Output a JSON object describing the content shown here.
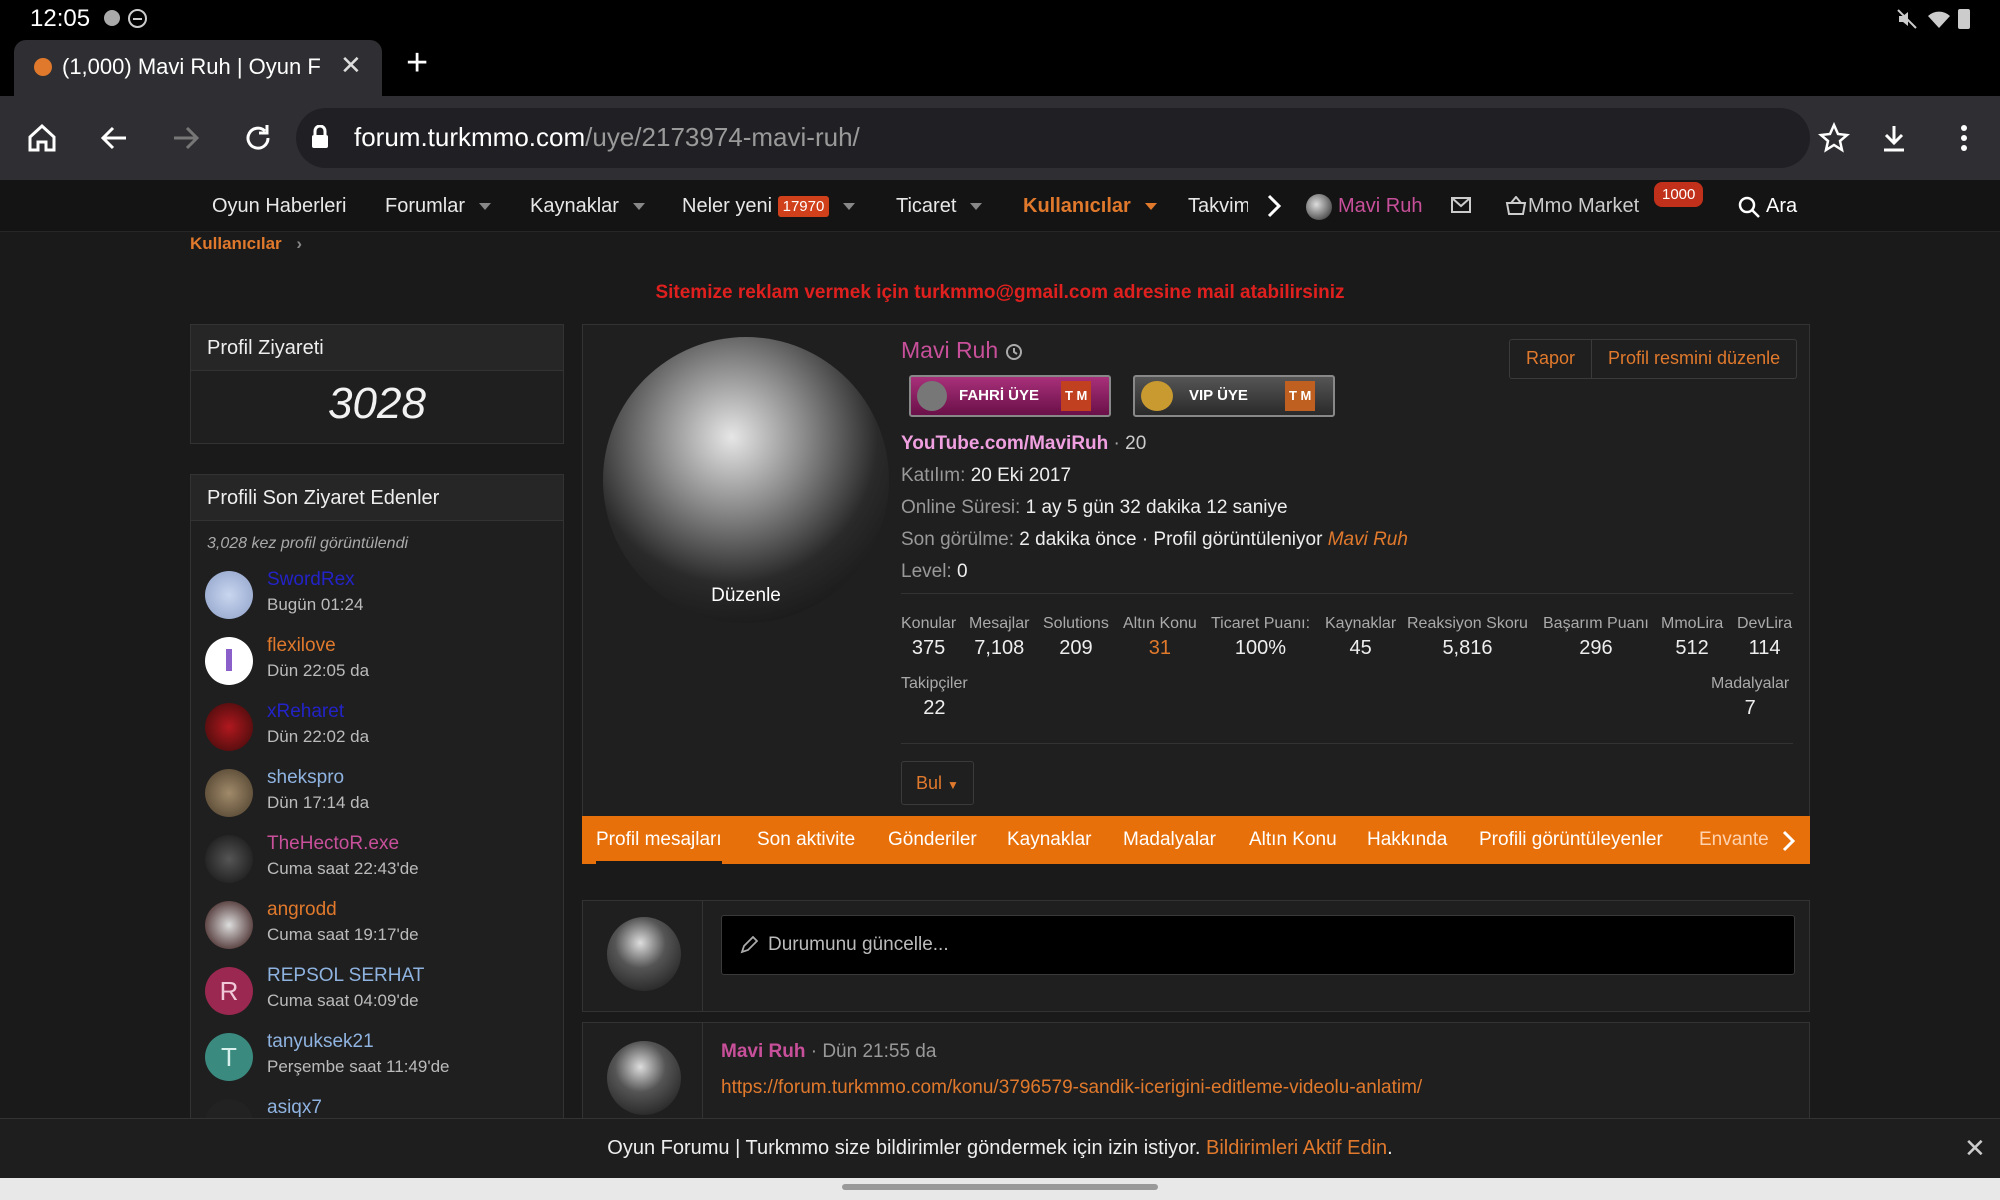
{
  "status_bar": {
    "time": "12:05"
  },
  "browser": {
    "tab_title": "(1,000) Mavi Ruh | Oyun F",
    "url_domain": "forum.turkmmo.com",
    "url_path": "/uye/2173974-mavi-ruh/"
  },
  "forum_nav": {
    "items": [
      "Oyun Haberleri",
      "Forumlar",
      "Kaynaklar",
      "Neler yeni",
      "Ticaret",
      "Kullanıcılar",
      "Takvim"
    ],
    "new_badge": "17970",
    "user_name": "Mavi Ruh",
    "market_label": "Mmo Market",
    "market_badge": "1000",
    "search_label": "Ara"
  },
  "breadcrumb": {
    "label": "Kullanıcılar"
  },
  "ad_banner": "Sitemize reklam vermek için turkmmo@gmail.com adresine mail atabilirsiniz",
  "sidebar": {
    "visits_title": "Profil Ziyareti",
    "visits_count": "3028",
    "recent_title": "Profili Son Ziyaret Edenler",
    "recent_summary": "3,028 kez profil görüntülendi",
    "visitors": [
      {
        "name": "SwordRex",
        "time": "Bugün 01:24",
        "color": "#2323c8"
      },
      {
        "name": "flexilove",
        "time": "Dün 22:05 da",
        "color": "#e0792c"
      },
      {
        "name": "xReharet",
        "time": "Dün 22:02 da",
        "color": "#2323c8"
      },
      {
        "name": "shekspro",
        "time": "Dün 17:14 da",
        "color": "#8fb3e0"
      },
      {
        "name": "TheHectoR.exe",
        "time": "Cuma saat 22:43'de",
        "color": "#c8509a"
      },
      {
        "name": "angrodd",
        "time": "Cuma saat 19:17'de",
        "color": "#e0792c"
      },
      {
        "name": "REPSOL SERHAT",
        "time": "Cuma saat 04:09'de",
        "color": "#8fb3e0"
      },
      {
        "name": "tanyuksek21",
        "time": "Perşembe saat 11:49'de",
        "color": "#8fb3e0"
      },
      {
        "name": "asiqx7",
        "time": "",
        "color": "#8fb3e0"
      }
    ],
    "avatar_letters": {
      "repsol": "R",
      "tanyuksek": "T"
    }
  },
  "profile": {
    "name": "Mavi Ruh",
    "edit_avatar": "Düzenle",
    "badge1": "FAHRİ ÜYE",
    "badge2": "VIP ÜYE",
    "badge_tm": "T M",
    "custom_title": "YouTube.com/MaviRuh",
    "age": "20",
    "joined_label": "Katılım:",
    "joined_value": "20 Eki 2017",
    "online_label": "Online Süresi:",
    "online_value": "1 ay 5 gün 32 dakika 12 saniye",
    "lastseen_label": "Son görülme:",
    "lastseen_value": "2 dakika önce · Profil görüntüleniyor",
    "lastseen_user": "Mavi Ruh",
    "level_label": "Level:",
    "level_value": "0",
    "report_button": "Rapor",
    "edit_button": "Profil resmini düzenle",
    "find_button": "Bul",
    "stats": [
      {
        "label": "Konular",
        "value": "375"
      },
      {
        "label": "Mesajlar",
        "value": "7,108"
      },
      {
        "label": "Solutions",
        "value": "209"
      },
      {
        "label": "Altın Konu",
        "value": "31"
      },
      {
        "label": "Ticaret Puanı:",
        "value": "100%"
      },
      {
        "label": "Kaynaklar",
        "value": "45"
      },
      {
        "label": "Reaksiyon Skoru",
        "value": "5,816"
      },
      {
        "label": "Başarım Puanı",
        "value": "296"
      },
      {
        "label": "MmoLira",
        "value": "512"
      },
      {
        "label": "DevLira",
        "value": "114"
      }
    ],
    "followers_label": "Takipçiler",
    "followers_value": "22",
    "medals_label": "Madalyalar",
    "medals_value": "7"
  },
  "profile_tabs": [
    "Profil mesajları",
    "Son aktivite",
    "Gönderiler",
    "Kaynaklar",
    "Madalyalar",
    "Altın Konu",
    "Hakkında",
    "Profili görüntüleyenler",
    "Envante"
  ],
  "status_update": {
    "placeholder": "Durumunu güncelle..."
  },
  "post": {
    "author": "Mavi Ruh",
    "time": "· Dün 21:55 da",
    "link": "https://forum.turkmmo.com/konu/3796579-sandik-icerigini-editleme-videolu-anlatim/"
  },
  "notification": {
    "text": "Oyun Forumu | Turkmmo size bildirimler göndermek için izin istiyor.",
    "link": "Bildirimleri Aktif Edin",
    "end": "."
  },
  "colors": {
    "accent": "#e0792c",
    "tab_bar": "#e8700a",
    "ad_red": "#e0201e",
    "badge_red": "#d0401a"
  }
}
